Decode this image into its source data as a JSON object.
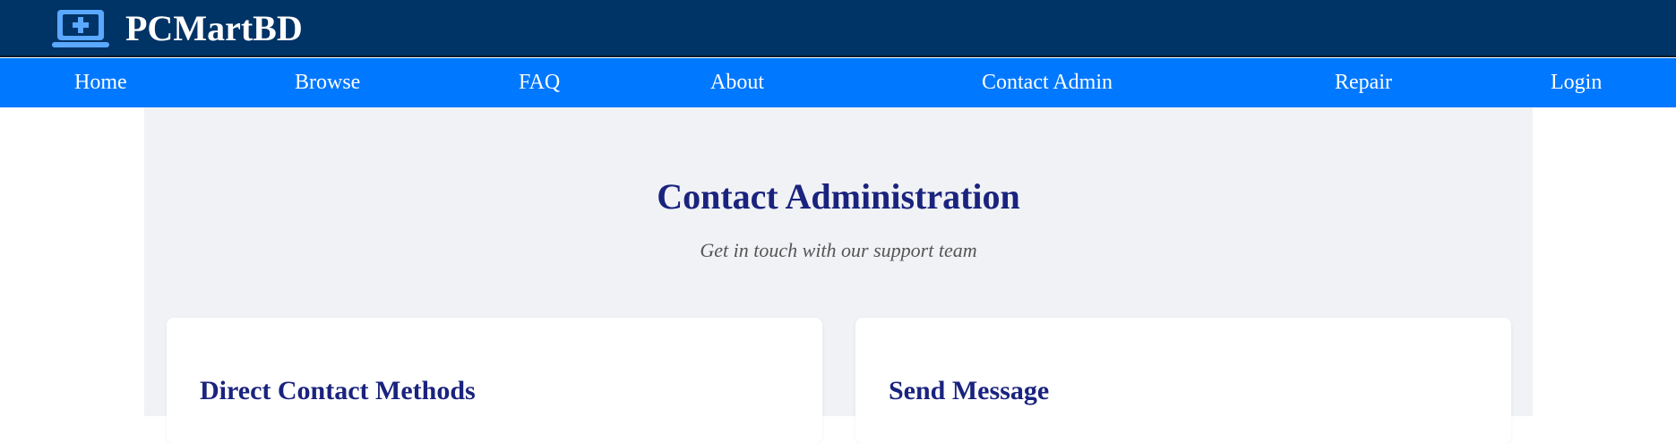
{
  "header": {
    "brand_name": "PCMartBD",
    "brand_icon": "laptop-plus-icon",
    "colors": {
      "background": "#003366",
      "icon": "#5aa8ff"
    }
  },
  "nav": {
    "background": "#0078ff",
    "items": [
      {
        "label": "Home"
      },
      {
        "label": "Browse"
      },
      {
        "label": "FAQ"
      },
      {
        "label": "About"
      },
      {
        "label": "Contact Admin"
      },
      {
        "label": "Repair"
      },
      {
        "label": "Login"
      }
    ]
  },
  "main": {
    "title": "Contact Administration",
    "subtitle": "Get in touch with our support team",
    "cards": [
      {
        "title": "Direct Contact Methods"
      },
      {
        "title": "Send Message"
      }
    ],
    "colors": {
      "heading": "#1a237e",
      "panel": "#f0f2f5"
    }
  }
}
